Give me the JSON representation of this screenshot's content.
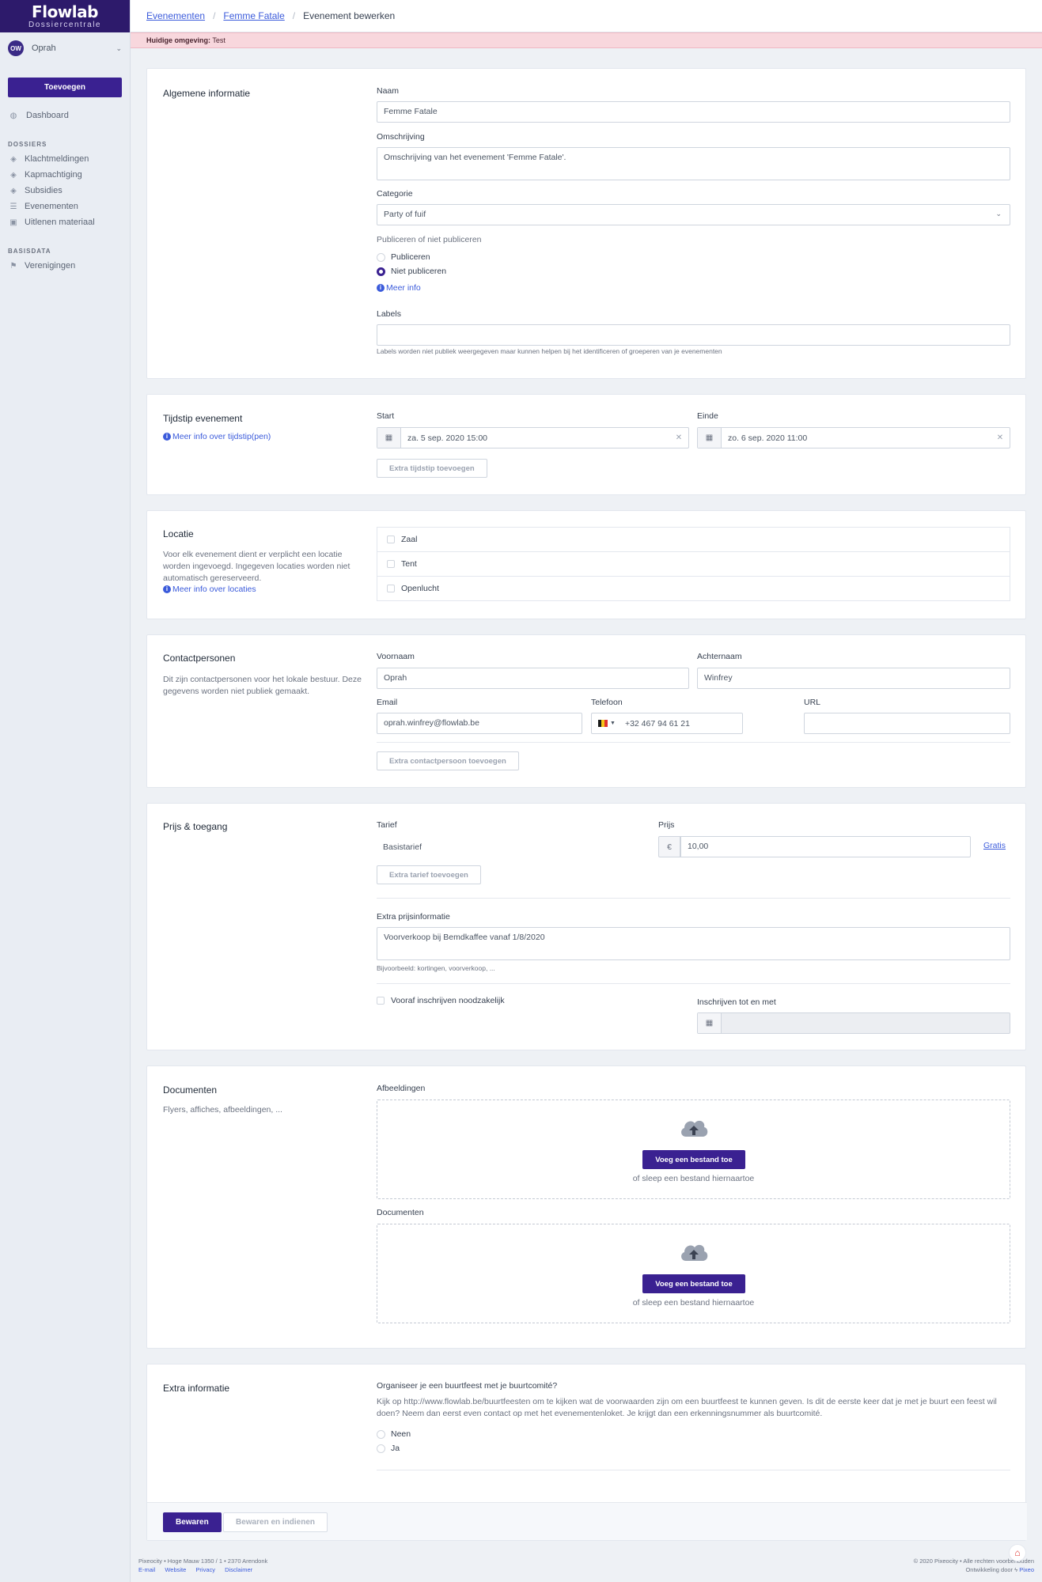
{
  "brand": {
    "name": "Flowlab",
    "subtitle": "Dossiercentrale"
  },
  "user": {
    "initials": "OW",
    "name": "Oprah"
  },
  "sidebar": {
    "add_label": "Toevoegen",
    "dashboard_label": "Dashboard",
    "dossiers_heading": "DOSSIERS",
    "dossiers": [
      {
        "label": "Klachtmeldingen",
        "icon": "layers-icon"
      },
      {
        "label": "Kapmachtiging",
        "icon": "layers-icon"
      },
      {
        "label": "Subsidies",
        "icon": "layers-icon"
      },
      {
        "label": "Evenementen",
        "icon": "list-icon"
      },
      {
        "label": "Uitlenen materiaal",
        "icon": "box-icon"
      }
    ],
    "basisdata_heading": "BASISDATA",
    "basisdata": [
      {
        "label": "Verenigingen",
        "icon": "flag-icon"
      }
    ]
  },
  "breadcrumb": {
    "item1": "Evenementen",
    "item2": "Femme Fatale",
    "current": "Evenement bewerken"
  },
  "environment": {
    "label": "Huidige omgeving:",
    "value": "Test"
  },
  "general": {
    "title": "Algemene informatie",
    "name_label": "Naam",
    "name_value": "Femme Fatale",
    "description_label": "Omschrijving",
    "description_value": "Omschrijving van het evenement 'Femme Fatale'.",
    "category_label": "Categorie",
    "category_value": "Party of fuif",
    "publish_label": "Publiceren of niet publiceren",
    "publish_option": "Publiceren",
    "nopublish_option": "Niet publiceren",
    "more_info": "Meer info",
    "labels_label": "Labels",
    "labels_help": "Labels worden niet publiek weergegeven maar kunnen helpen bij het identificeren of groeperen van je evenementen"
  },
  "timing": {
    "title": "Tijdstip evenement",
    "more_info": "Meer info over tijdstip(pen)",
    "start_label": "Start",
    "start_value": "za. 5 sep. 2020 15:00",
    "end_label": "Einde",
    "end_value": "zo. 6 sep. 2020 11:00",
    "add_label": "Extra tijdstip toevoegen"
  },
  "location": {
    "title": "Locatie",
    "description": "Voor elk evenement dient er verplicht een locatie worden ingevoegd. Ingegeven locaties worden niet automatisch gereserveerd.",
    "more_info": "Meer info over locaties",
    "options": [
      "Zaal",
      "Tent",
      "Openlucht"
    ]
  },
  "contacts": {
    "title": "Contactpersonen",
    "description": "Dit zijn contactpersonen voor het lokale bestuur. Deze gegevens worden niet publiek gemaakt.",
    "firstname_label": "Voornaam",
    "firstname_value": "Oprah",
    "lastname_label": "Achternaam",
    "lastname_value": "Winfrey",
    "email_label": "Email",
    "email_value": "oprah.winfrey@flowlab.be",
    "phone_label": "Telefoon",
    "phone_value": "+32 467 94 61 21",
    "url_label": "URL",
    "add_label": "Extra contactpersoon toevoegen"
  },
  "pricing": {
    "title": "Prijs & toegang",
    "tariff_label": "Tarief",
    "tariff_value": "Basistarief",
    "price_label": "Prijs",
    "currency": "€",
    "price_value": "10,00",
    "free_link": "Gratis",
    "add_label": "Extra tarief toevoegen",
    "extra_label": "Extra prijsinformatie",
    "extra_value": "Voorverkoop bij Bemdkaffee vanaf 1/8/2020",
    "extra_help": "Bijvoorbeeld: kortingen, voorverkoop, ...",
    "preregister_label": "Vooraf inschrijven noodzakelijk",
    "register_until_label": "Inschrijven tot en met"
  },
  "documents": {
    "title": "Documenten",
    "description": "Flyers, affiches, afbeeldingen, ...",
    "images_label": "Afbeeldingen",
    "docs_label": "Documenten",
    "upload_label": "Voeg een bestand toe",
    "drop_hint": "of sleep een bestand hiernaartoe"
  },
  "extra": {
    "title": "Extra informatie",
    "question": "Organiseer je een buurtfeest met je buurtcomité?",
    "text": "Kijk op http://www.flowlab.be/buurtfeesten om te kijken wat de voorwaarden zijn om een buurtfeest te kunnen geven. Is dit de eerste keer dat je met je buurt een feest wil doen? Neem dan eerst even contact op met het evenementenloket. Je krijgt dan een erkenningsnummer als buurtcomité.",
    "option_no": "Neen",
    "option_yes": "Ja"
  },
  "actions": {
    "save": "Bewaren",
    "save_submit": "Bewaren en indienen"
  },
  "footer": {
    "address": "Pixeocity • Hoge Mauw 1350 / 1 • 2370 Arendonk",
    "links": [
      "E-mail",
      "Website",
      "Privacy",
      "Disclaimer"
    ],
    "copyright": "© 2020 Pixeocity • Alle rechten voorbehouden",
    "developed_by": "Ontwikkeling door",
    "developer": "Pixeo"
  }
}
